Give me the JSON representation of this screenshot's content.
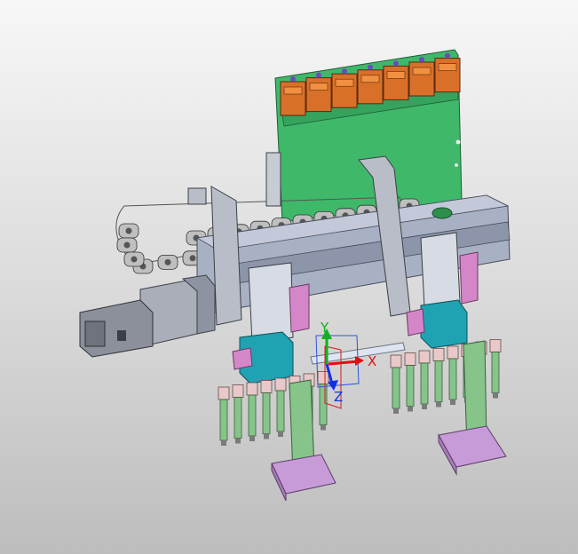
{
  "viewer": {
    "background_top": "#f7f7f7",
    "background_bottom": "#bdbdbd"
  },
  "triad": {
    "x_label": "X",
    "y_label": "Y",
    "z_label": "Z",
    "x_color": "#e01010",
    "y_color": "#10b020",
    "z_color": "#1030e0"
  },
  "model": {
    "plate_color": "#3fb86a",
    "relay_color": "#d9702a",
    "rail_color": "#a8b0c4",
    "chain_color": "#6b6b6b",
    "bracket_color": "#b9bdc7",
    "slide_color": "#8ea6c9",
    "block_color": "#1fa3b3",
    "pink_color": "#d486c8",
    "post_color": "#86c48a",
    "base_color": "#c79ad8"
  }
}
